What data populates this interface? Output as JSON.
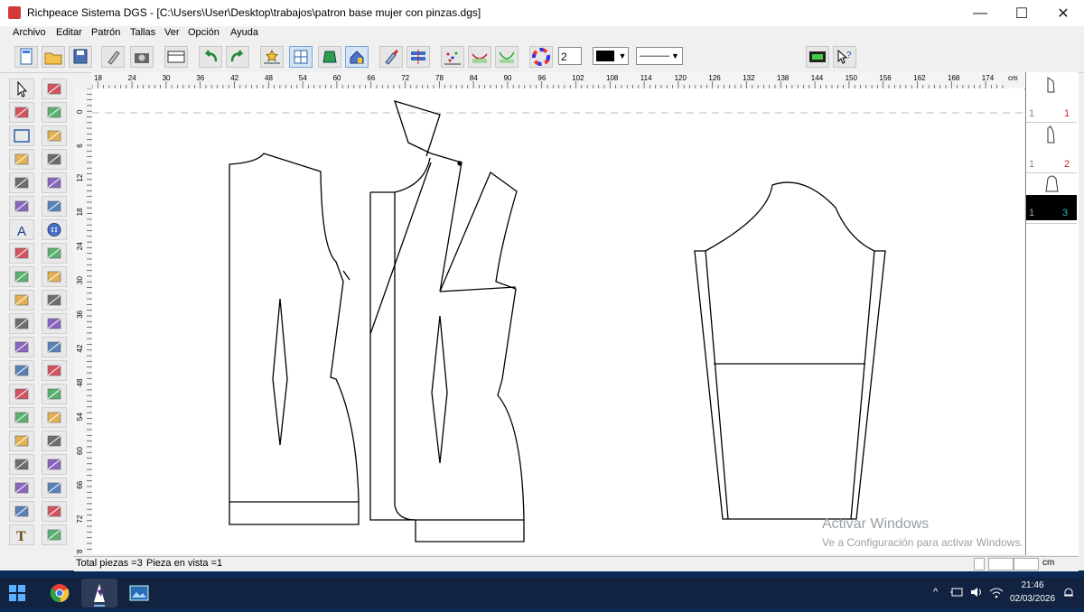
{
  "window": {
    "title": "Richpeace Sistema DGS - [C:\\Users\\User\\Desktop\\trabajos\\patron base mujer con pinzas.dgs]",
    "controls": {
      "minimize": "—",
      "maximize": "☐",
      "close": "✕"
    }
  },
  "menu": [
    "Archivo",
    "Editar",
    "Patrón",
    "Tallas",
    "Ver",
    "Opción",
    "Ayuda"
  ],
  "toolbar": {
    "line_width_value": "2",
    "color_dropdown_value": "■",
    "line_style_value": "———"
  },
  "ruler": {
    "unit": "cm",
    "h_ticks": [
      "18",
      "24",
      "30",
      "36",
      "42",
      "48",
      "54",
      "60",
      "66",
      "72",
      "78",
      "84",
      "90",
      "96",
      "102",
      "108",
      "114",
      "120",
      "126",
      "132",
      "138",
      "144",
      "150",
      "156",
      "162",
      "168",
      "174"
    ],
    "v_ticks": [
      "0",
      "6",
      "12",
      "18",
      "24",
      "30",
      "36",
      "42",
      "48",
      "54",
      "60",
      "66",
      "72",
      "78"
    ]
  },
  "pieces_panel": [
    {
      "left": "1",
      "right": "1"
    },
    {
      "left": "1",
      "right": "2"
    },
    {
      "left": "1",
      "right": "3",
      "selected": true
    }
  ],
  "status": {
    "total": "Total piezas =3",
    "view": "Pieza en vista =1",
    "unit": "cm"
  },
  "watermark": {
    "line1": "Activar Windows",
    "line2": "Ve a Configuración para activar Windows."
  },
  "taskbar": {
    "time": "21:46",
    "date": "02/03/2026"
  },
  "colors": {
    "canvas": "#ffffff",
    "pattern_line": "#000000",
    "selected_thumb": "#000000",
    "thumb_number": "#cc2222"
  }
}
